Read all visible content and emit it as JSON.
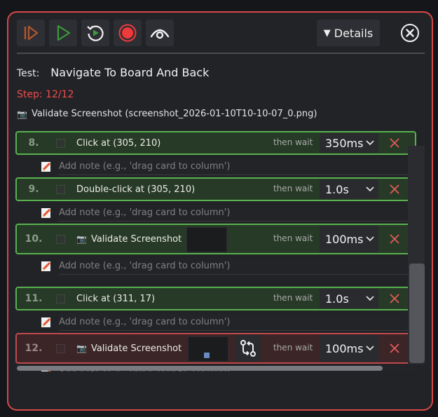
{
  "toolbar": {
    "details_label": "Details",
    "colors": {
      "step_orange": "#b2572e",
      "play_green": "#3b9a3b",
      "record_red": "#ee3a3a",
      "accent_border": "#d8484a"
    }
  },
  "test": {
    "label": "Test:",
    "name": "Navigate To Board And Back"
  },
  "step_counter": "Step: 12/12",
  "current_step": {
    "icon": "camera-icon",
    "text": "Validate Screenshot (screenshot_2026-01-10T10-10-07_0.png)"
  },
  "then_wait_label": "then wait",
  "note_placeholder": "Add note (e.g., 'drag card to column')",
  "steps": [
    {
      "num": "8.",
      "label": "Click at (305, 210)",
      "wait": "350ms",
      "status": "ok"
    },
    {
      "num": "9.",
      "label": "Double-click at (305, 210)",
      "wait": "1.0s",
      "status": "ok"
    },
    {
      "num": "10.",
      "label": "Validate Screenshot",
      "icon": "camera-icon",
      "wait": "100ms",
      "status": "ok"
    },
    {
      "num": "11.",
      "label": "Click at (311, 17)",
      "wait": "1.0s",
      "status": "ok"
    },
    {
      "num": "12.",
      "label": "Validate Screenshot",
      "icon": "camera-icon",
      "wait": "100ms",
      "status": "error"
    }
  ]
}
